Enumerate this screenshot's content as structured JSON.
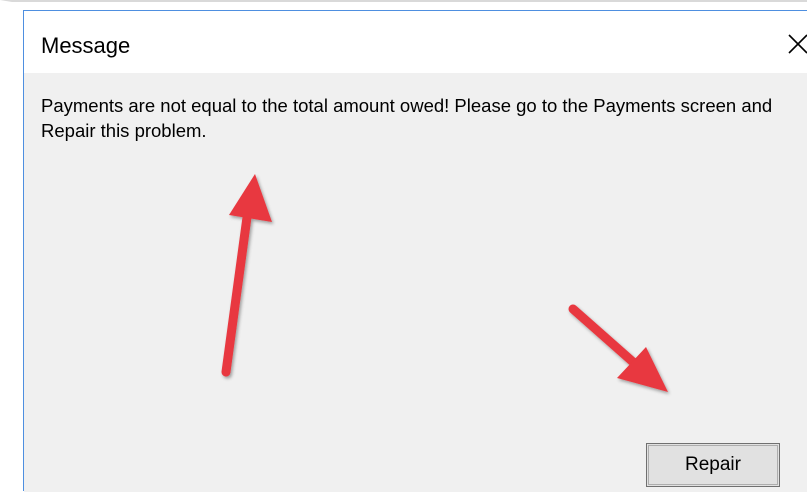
{
  "window": {
    "title": "Message",
    "close_icon": "close-icon"
  },
  "message": {
    "text": "Payments are not equal to the total amount owed!  Please go to the Payments screen and Repair this problem."
  },
  "actions": {
    "repair_label": "Repair"
  },
  "annotations": {
    "arrow_color": "#e8393f",
    "arrows": [
      "arrow-icon",
      "arrow-icon"
    ]
  }
}
